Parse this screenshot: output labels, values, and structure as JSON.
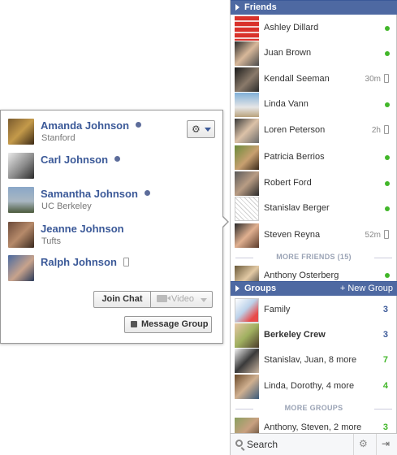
{
  "colors": {
    "accent": "#3b5998",
    "header_bg": "#4e69a2",
    "online": "#42b72a",
    "count_blue": "#3b5998",
    "count_green": "#42b72a"
  },
  "group_card": {
    "members": [
      {
        "name": "Amanda Johnson",
        "subtitle": "Stanford",
        "status": "online"
      },
      {
        "name": "Carl Johnson",
        "subtitle": "",
        "status": "online"
      },
      {
        "name": "Samantha Johnson",
        "subtitle": "UC Berkeley",
        "status": "online"
      },
      {
        "name": "Jeanne Johnson",
        "subtitle": "Tufts",
        "status": "none"
      },
      {
        "name": "Ralph Johnson",
        "subtitle": "",
        "status": "mobile"
      }
    ],
    "settings_icon": "gear-icon",
    "join_chat_label": "Join Chat",
    "video_label": "Video",
    "message_group_label": "Message Group"
  },
  "sidebar": {
    "friends_title": "Friends",
    "friends": [
      {
        "name": "Ashley Dillard",
        "status": "online",
        "idle": ""
      },
      {
        "name": "Juan Brown",
        "status": "online",
        "idle": ""
      },
      {
        "name": "Kendall Seeman",
        "status": "mobile",
        "idle": "30m"
      },
      {
        "name": "Linda Vann",
        "status": "online",
        "idle": ""
      },
      {
        "name": "Loren Peterson",
        "status": "mobile",
        "idle": "2h"
      },
      {
        "name": "Patricia Berrios",
        "status": "online",
        "idle": ""
      },
      {
        "name": "Robert Ford",
        "status": "online",
        "idle": ""
      },
      {
        "name": "Stanislav Berger",
        "status": "online",
        "idle": ""
      },
      {
        "name": "Steven Reyna",
        "status": "mobile",
        "idle": "52m"
      }
    ],
    "more_friends_label": "MORE FRIENDS (15)",
    "more_friends": [
      {
        "name": "Anthony Osterberg",
        "status": "online"
      }
    ],
    "groups_title": "Groups",
    "new_group_label": "+ New Group",
    "groups": [
      {
        "name": "Family",
        "count": "3",
        "count_color": "blue",
        "bold": false
      },
      {
        "name": "Berkeley Crew",
        "count": "3",
        "count_color": "blue",
        "bold": true
      },
      {
        "name": "Stanislav, Juan, 8 more",
        "count": "7",
        "count_color": "green",
        "bold": false
      },
      {
        "name": "Linda, Dorothy, 4 more",
        "count": "4",
        "count_color": "green",
        "bold": false
      }
    ],
    "more_groups_label": "MORE GROUPS",
    "more_groups": [
      {
        "name": "Anthony, Steven, 2 more",
        "count": "3",
        "count_color": "green"
      }
    ],
    "search_placeholder": "Search"
  }
}
